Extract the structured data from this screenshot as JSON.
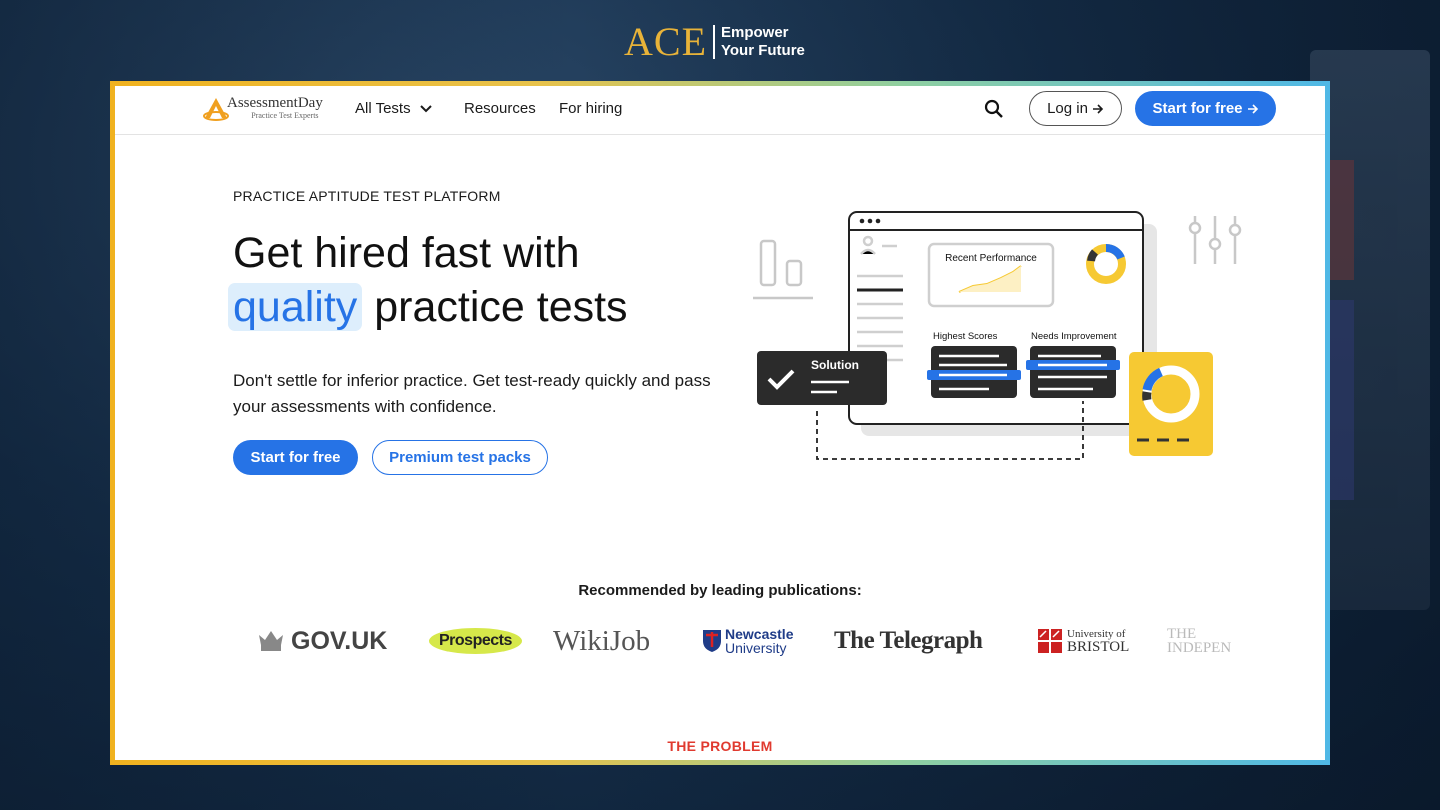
{
  "brand": {
    "logo": "ACE",
    "tagline_line1": "Empower",
    "tagline_line2": "Your Future"
  },
  "nav": {
    "logo_name": "AssessmentDay",
    "logo_sub": "Practice Test Experts",
    "links": [
      "All Tests",
      "Resources",
      "For hiring"
    ],
    "login_label": "Log in",
    "start_label": "Start for free",
    "icons": {
      "search": "search-icon",
      "dropdown": "chevron-down-icon",
      "arrow": "arrow-right-icon"
    }
  },
  "hero": {
    "eyebrow": "PRACTICE APTITUDE TEST PLATFORM",
    "headline_line1": "Get hired fast with",
    "headline_highlight": "quality",
    "headline_rest": " practice tests",
    "subtext": "Don't settle for inferior practice. Get test-ready quickly and pass your assessments with confidence.",
    "primary_cta": "Start for free",
    "secondary_cta": "Premium test packs",
    "accent_color": "#2673e6"
  },
  "illustration": {
    "recent_performance": "Recent Performance",
    "highest_scores": "Highest Scores",
    "needs_improvement": "Needs Improvement",
    "solution": "Solution"
  },
  "publications": {
    "title": "Recommended by leading publications:",
    "items": [
      "GOV.UK",
      "Prospects",
      "WikiJob",
      "Newcastle",
      "University",
      "The Telegraph",
      "University of",
      "BRISTOL",
      "THE",
      "INDEPEN"
    ]
  },
  "next_section": {
    "label": "THE PROBLEM",
    "color": "#e03a2f"
  }
}
